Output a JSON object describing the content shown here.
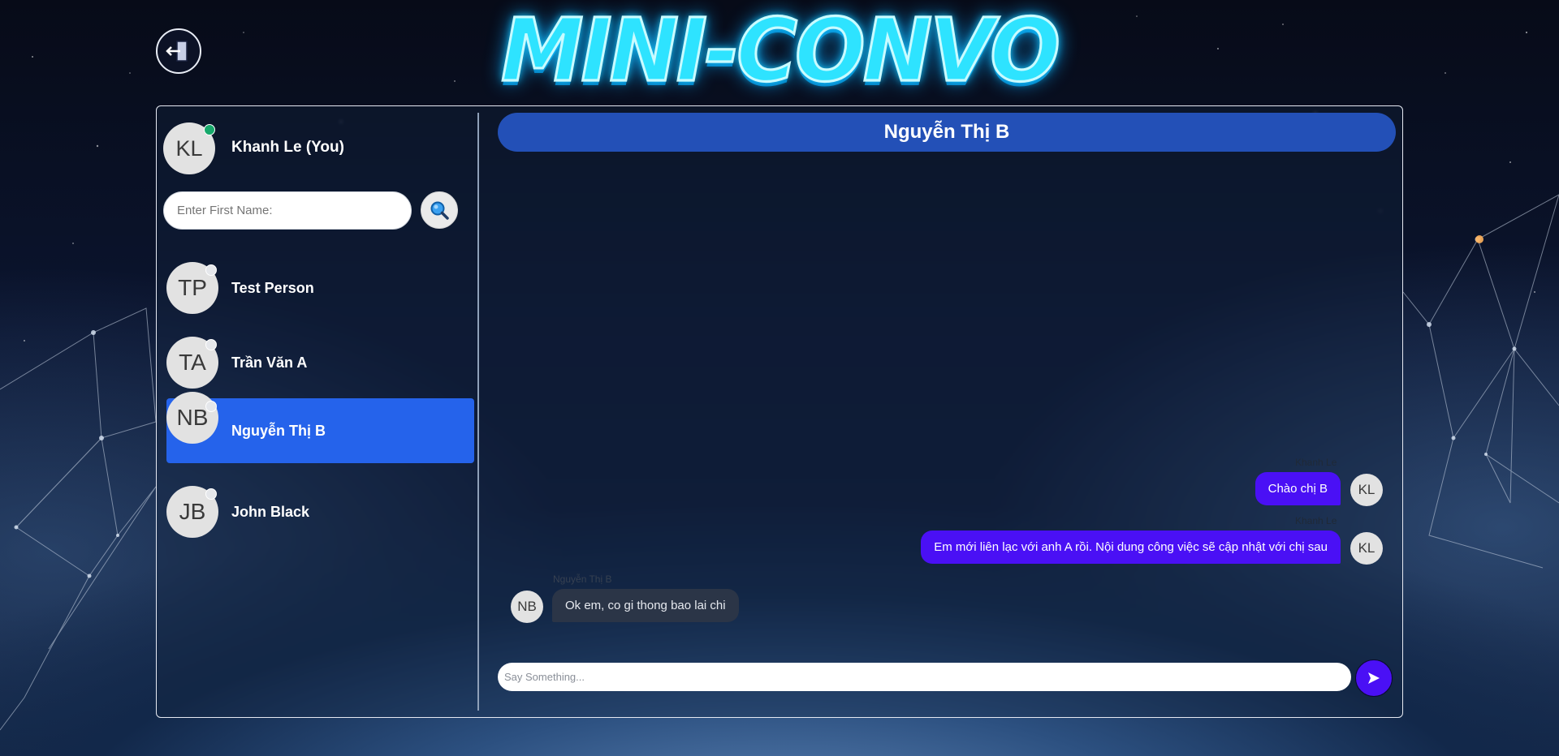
{
  "app": {
    "title": "MINI-CONVO"
  },
  "current_user": {
    "initials": "KL",
    "name": "Khanh Le (You)",
    "online": true,
    "status_color": "#17a86b"
  },
  "search": {
    "placeholder": "Enter First Name:",
    "value": "",
    "button_icon": "search-icon"
  },
  "contacts": [
    {
      "initials": "TP",
      "name": "Test Person",
      "active": false
    },
    {
      "initials": "TA",
      "name": "Trần Văn A",
      "active": false
    },
    {
      "initials": "NB",
      "name": "Nguyễn Thị B",
      "active": true
    },
    {
      "initials": "JB",
      "name": "John Black",
      "active": false
    }
  ],
  "chat": {
    "title": "Nguyễn Thị B",
    "messages": [
      {
        "direction": "out",
        "sender": "Khanh Le",
        "initials": "KL",
        "text": "Chào chị B"
      },
      {
        "direction": "out",
        "sender": "Khanh Le",
        "initials": "KL",
        "text": "Em mới liên lạc với anh A rồi. Nội dung công việc sẽ cập nhật với chị sau"
      },
      {
        "direction": "in",
        "sender": "Nguyễn Thị B",
        "initials": "NB",
        "text": "Ok em, co gi thong bao lai chi"
      }
    ],
    "composer": {
      "placeholder": "Say Something...",
      "value": ""
    },
    "send_icon": "send-arrow-icon"
  },
  "colors": {
    "accent": "#2563eb",
    "header": "#2350b7",
    "outgoing_bubble": "#4a10f5",
    "incoming_bubble": "#2b3547",
    "logo": "#2ee3ff"
  }
}
